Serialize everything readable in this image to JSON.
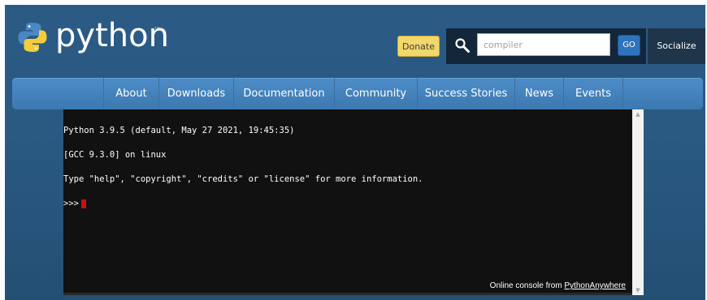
{
  "header": {
    "logo_text": "python",
    "trademark": "™",
    "donate_label": "Donate",
    "search_value": "compiler",
    "go_label": "GO",
    "socialize_label": "Socialize"
  },
  "nav": {
    "items": [
      {
        "label": "About"
      },
      {
        "label": "Downloads"
      },
      {
        "label": "Documentation"
      },
      {
        "label": "Community"
      },
      {
        "label": "Success Stories"
      },
      {
        "label": "News"
      },
      {
        "label": "Events"
      }
    ]
  },
  "console": {
    "lines": [
      "Python 3.9.5 (default, May 27 2021, 19:45:35)",
      "[GCC 9.3.0] on linux",
      "Type \"help\", \"copyright\", \"credits\" or \"license\" for more information."
    ],
    "prompt": ">>>",
    "credit_prefix": "Online console from ",
    "credit_link": "PythonAnywhere"
  },
  "colors": {
    "background": "#2b5b84",
    "nav": "#4d8dc8",
    "donate": "#f2d86a",
    "go": "#2f73bd",
    "console": "#111111",
    "cursor": "#cc1010"
  },
  "icons": {
    "logo": "python-logo-icon",
    "search": "magnifier-icon"
  }
}
